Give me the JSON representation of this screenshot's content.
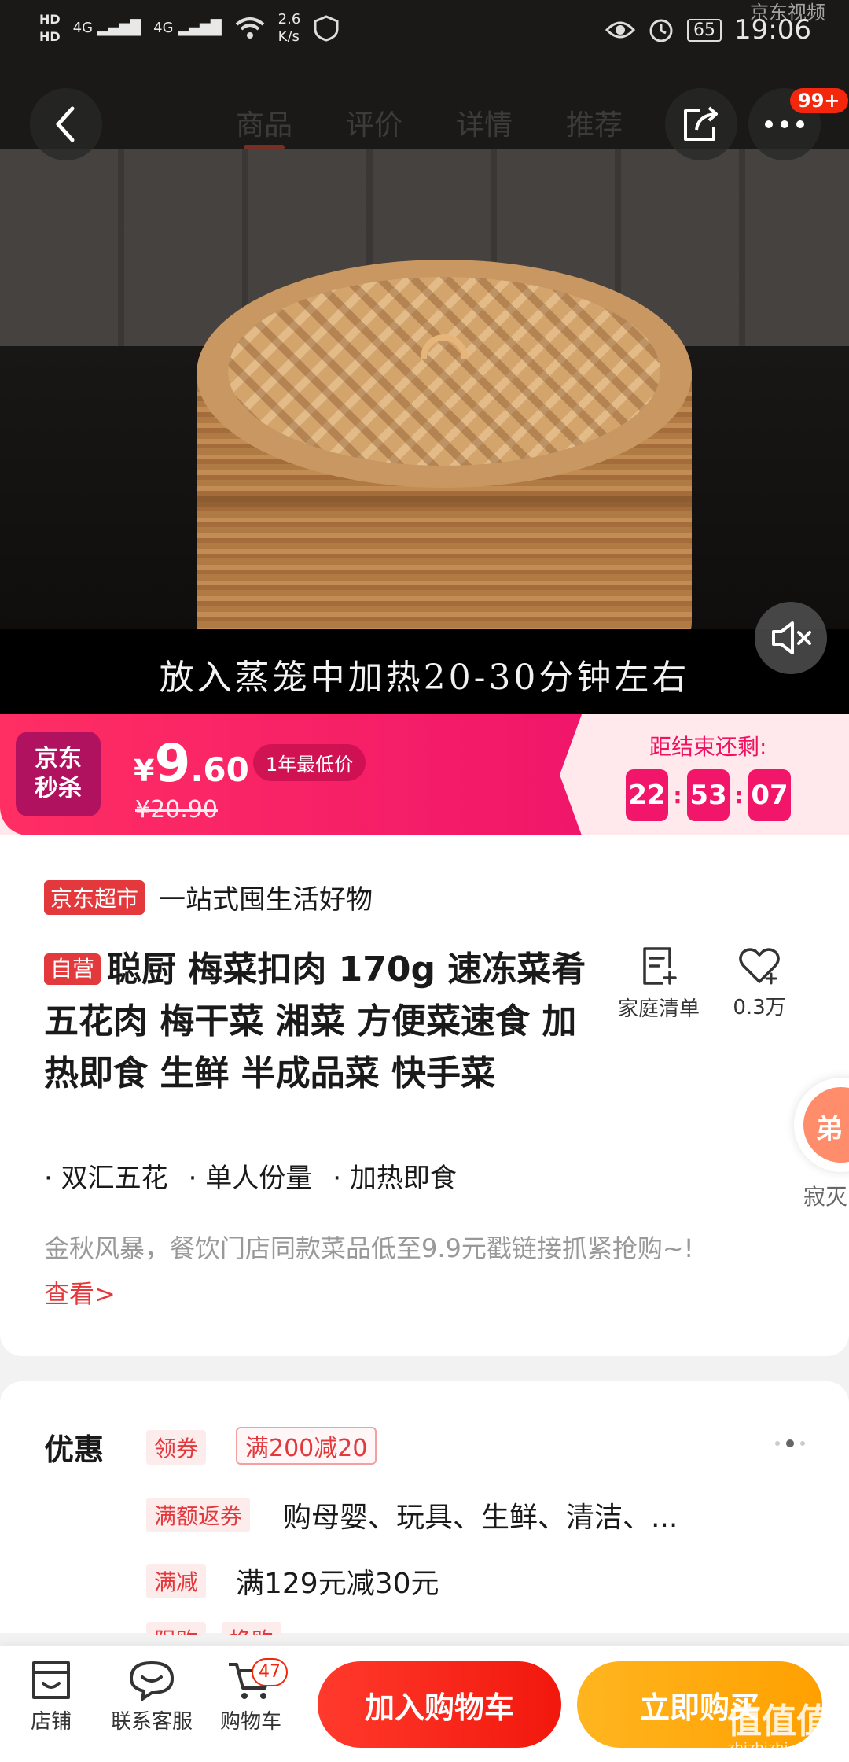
{
  "status_bar": {
    "speed": "2.6",
    "speed_unit": "K/s",
    "network_1": "4G",
    "network_2": "4G",
    "battery": "65",
    "time": "19:06",
    "video_brand": "京东视频"
  },
  "nav": {
    "tabs": [
      "商品",
      "评价",
      "详情",
      "推荐"
    ],
    "active_tab": "商品",
    "more_badge": "99+"
  },
  "video": {
    "subtitle": "放入蒸笼中加热20-30分钟左右"
  },
  "seckill": {
    "logo_line1": "京东",
    "logo_line2": "秒杀",
    "currency": "¥",
    "price_int": "9",
    "price_dec": ".60",
    "lowest_tag": "1年最低价",
    "original_price": "¥20.90",
    "end_label": "距结束还剩:",
    "hours": "22",
    "minutes": "53",
    "seconds": "07",
    "brand_color": "#f0166a"
  },
  "product": {
    "market_tag": "京东超市",
    "market_slogan": "一站式囤生活好物",
    "self_tag": "自营",
    "title": "聪厨 梅菜扣肉 170g  速冻菜肴 五花肉 梅干菜 湘菜 方便菜速食 加热即食 生鲜 半成品菜 快手菜",
    "list_label": "家庭清单",
    "fav_count": "0.3万",
    "bullets": [
      "双汇五花",
      "单人份量",
      "加热即食"
    ],
    "promo_text": "金秋风暴，餐饮门店同款菜品低至9.9元戳链接抓紧抢购~!",
    "view_link": "查看>",
    "float_char": "弟",
    "float_label": "寂灭"
  },
  "discounts": {
    "title": "优惠",
    "coupon_tag": "领券",
    "coupon": "满200减20",
    "rebate_tag": "满额返券",
    "rebate_text": "购母婴、玩具、生鲜、清洁、...",
    "reduce_tag": "满减",
    "reduce_text": "满129元减30元",
    "limit_tag": "限购",
    "swap_tag": "换购"
  },
  "bottom_bar": {
    "shop": "店铺",
    "service": "联系客服",
    "cart": "购物车",
    "cart_count": "47",
    "add_to_cart": "加入购物车",
    "buy_now": "立即购买",
    "watermark": "值值值",
    "watermark_sub": "zhizhizhi.com"
  }
}
